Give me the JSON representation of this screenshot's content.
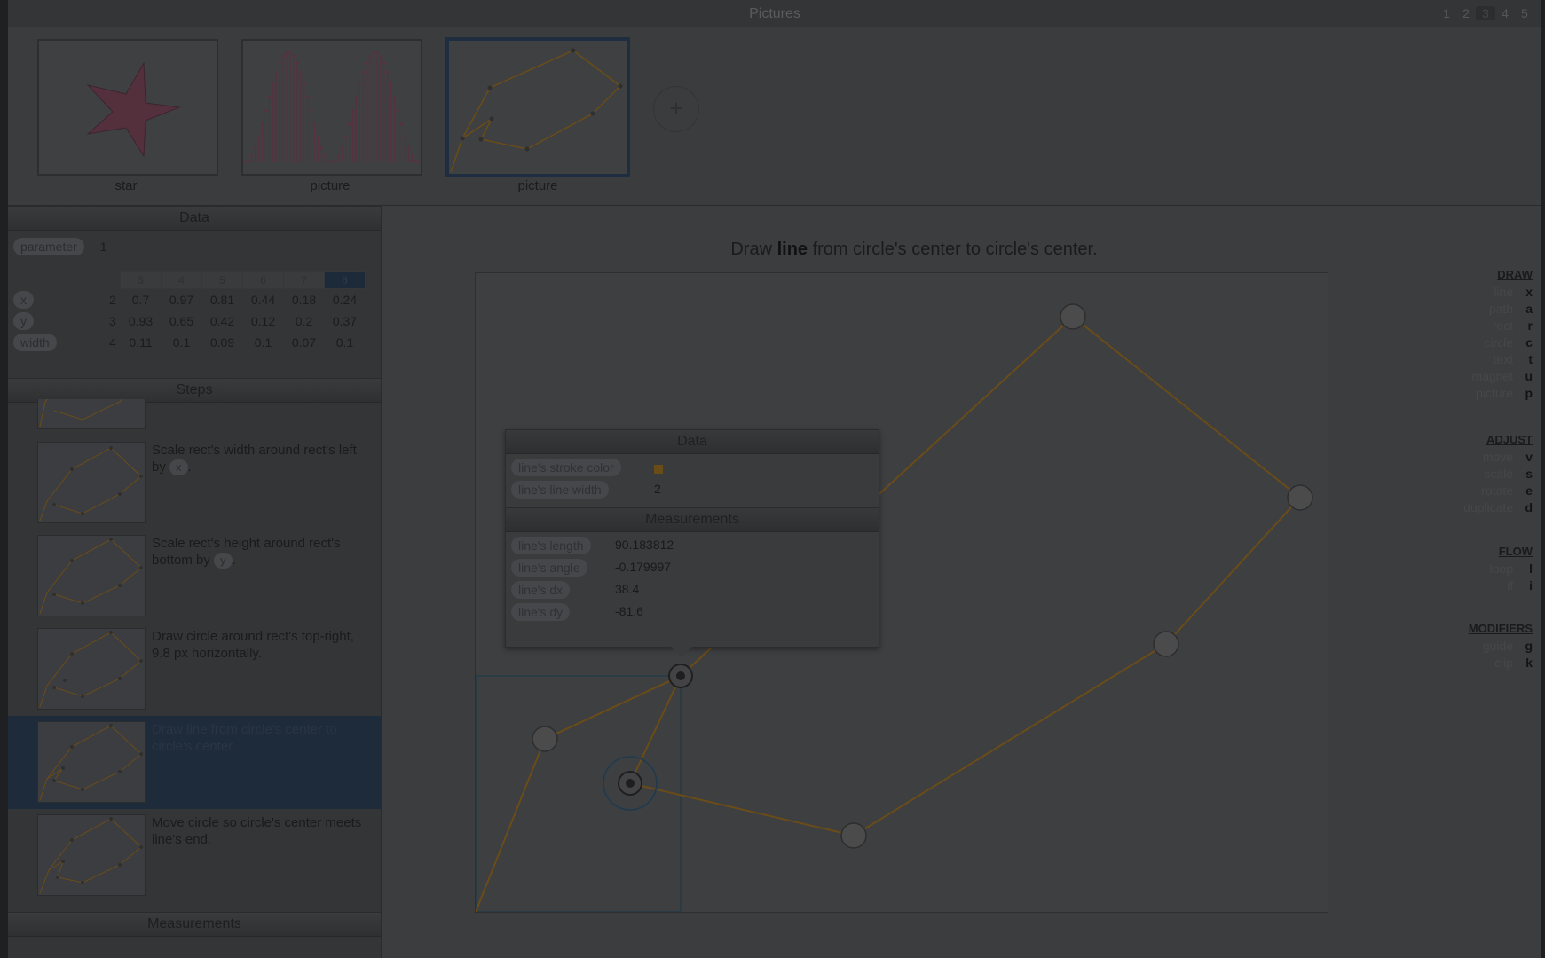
{
  "window": {
    "title": "Pictures",
    "pages": [
      "1",
      "2",
      "3",
      "4",
      "5"
    ],
    "current_page": "3"
  },
  "thumbnails": [
    {
      "label": "star"
    },
    {
      "label": "picture"
    },
    {
      "label": "picture"
    }
  ],
  "add_button": "+",
  "data_panel": {
    "header": "Data",
    "parameter_label": "parameter",
    "parameter_value": "1",
    "columns": [
      "3",
      "4",
      "5",
      "6",
      "7",
      "8"
    ],
    "selected_column": "8",
    "rows": [
      {
        "label": "x",
        "index": "2",
        "values": [
          "0.7",
          "0.97",
          "0.81",
          "0.44",
          "0.18",
          "0.24"
        ]
      },
      {
        "label": "y",
        "index": "3",
        "values": [
          "0.93",
          "0.65",
          "0.42",
          "0.12",
          "0.2",
          "0.37"
        ]
      },
      {
        "label": "width",
        "index": "4",
        "values": [
          "0.11",
          "0.1",
          "0.09",
          "0.1",
          "0.07",
          "0.1"
        ]
      }
    ]
  },
  "steps_panel": {
    "header": "Steps",
    "items": [
      {
        "pre": "Scale rect's width around rect's left by ",
        "pill": "x",
        "post": "."
      },
      {
        "pre": "Scale rect's height around rect's bottom by ",
        "pill": "y",
        "post": "."
      },
      {
        "pre": "Draw circle around rect's top-right, 9.8 px horizontally.",
        "pill": "",
        "post": ""
      },
      {
        "pre": "Draw line from circle's center to circle's center.",
        "pill": "",
        "post": ""
      },
      {
        "pre": "Move circle so circle's center meets line's end.",
        "pill": "",
        "post": ""
      }
    ],
    "selected_index": 3
  },
  "measurements_panel": {
    "header": "Measurements"
  },
  "prompt": {
    "pre": "Draw ",
    "bold": "line",
    "post": " from circle's center to circle's center."
  },
  "popup": {
    "data_header": "Data",
    "data_rows": [
      {
        "label": "line's stroke color",
        "value": "",
        "color": "#6a4c18"
      },
      {
        "label": "line's line width",
        "value": "2"
      }
    ],
    "measurements_header": "Measurements",
    "measurement_rows": [
      {
        "label": "line's length",
        "value": "90.183812"
      },
      {
        "label": "line's angle",
        "value": "-0.179997"
      },
      {
        "label": "line's dx",
        "value": "38.4"
      },
      {
        "label": "line's dy",
        "value": "-81.6"
      }
    ]
  },
  "tool_menu": {
    "draw": {
      "header": "DRAW",
      "items": [
        [
          "line",
          "x"
        ],
        [
          "path",
          "a"
        ],
        [
          "rect",
          "r"
        ],
        [
          "circle",
          "c"
        ],
        [
          "text",
          "t"
        ],
        [
          "magnet",
          "u"
        ],
        [
          "picture",
          "p"
        ]
      ]
    },
    "adjust": {
      "header": "ADJUST",
      "items": [
        [
          "move",
          "v"
        ],
        [
          "scale",
          "s"
        ],
        [
          "rotate",
          "e"
        ],
        [
          "duplicate",
          "d"
        ]
      ]
    },
    "flow": {
      "header": "FLOW",
      "items": [
        [
          "loop",
          "l"
        ],
        [
          "if",
          "i"
        ]
      ]
    },
    "modifiers": {
      "header": "MODIFIERS",
      "items": [
        [
          "guide",
          "g"
        ],
        [
          "clip",
          "k"
        ]
      ]
    }
  },
  "colors": {
    "shape_stroke": "#6a4c18",
    "selection": "#1d2b3b",
    "star_fill": "#54303c",
    "wave": "#5a3040"
  }
}
